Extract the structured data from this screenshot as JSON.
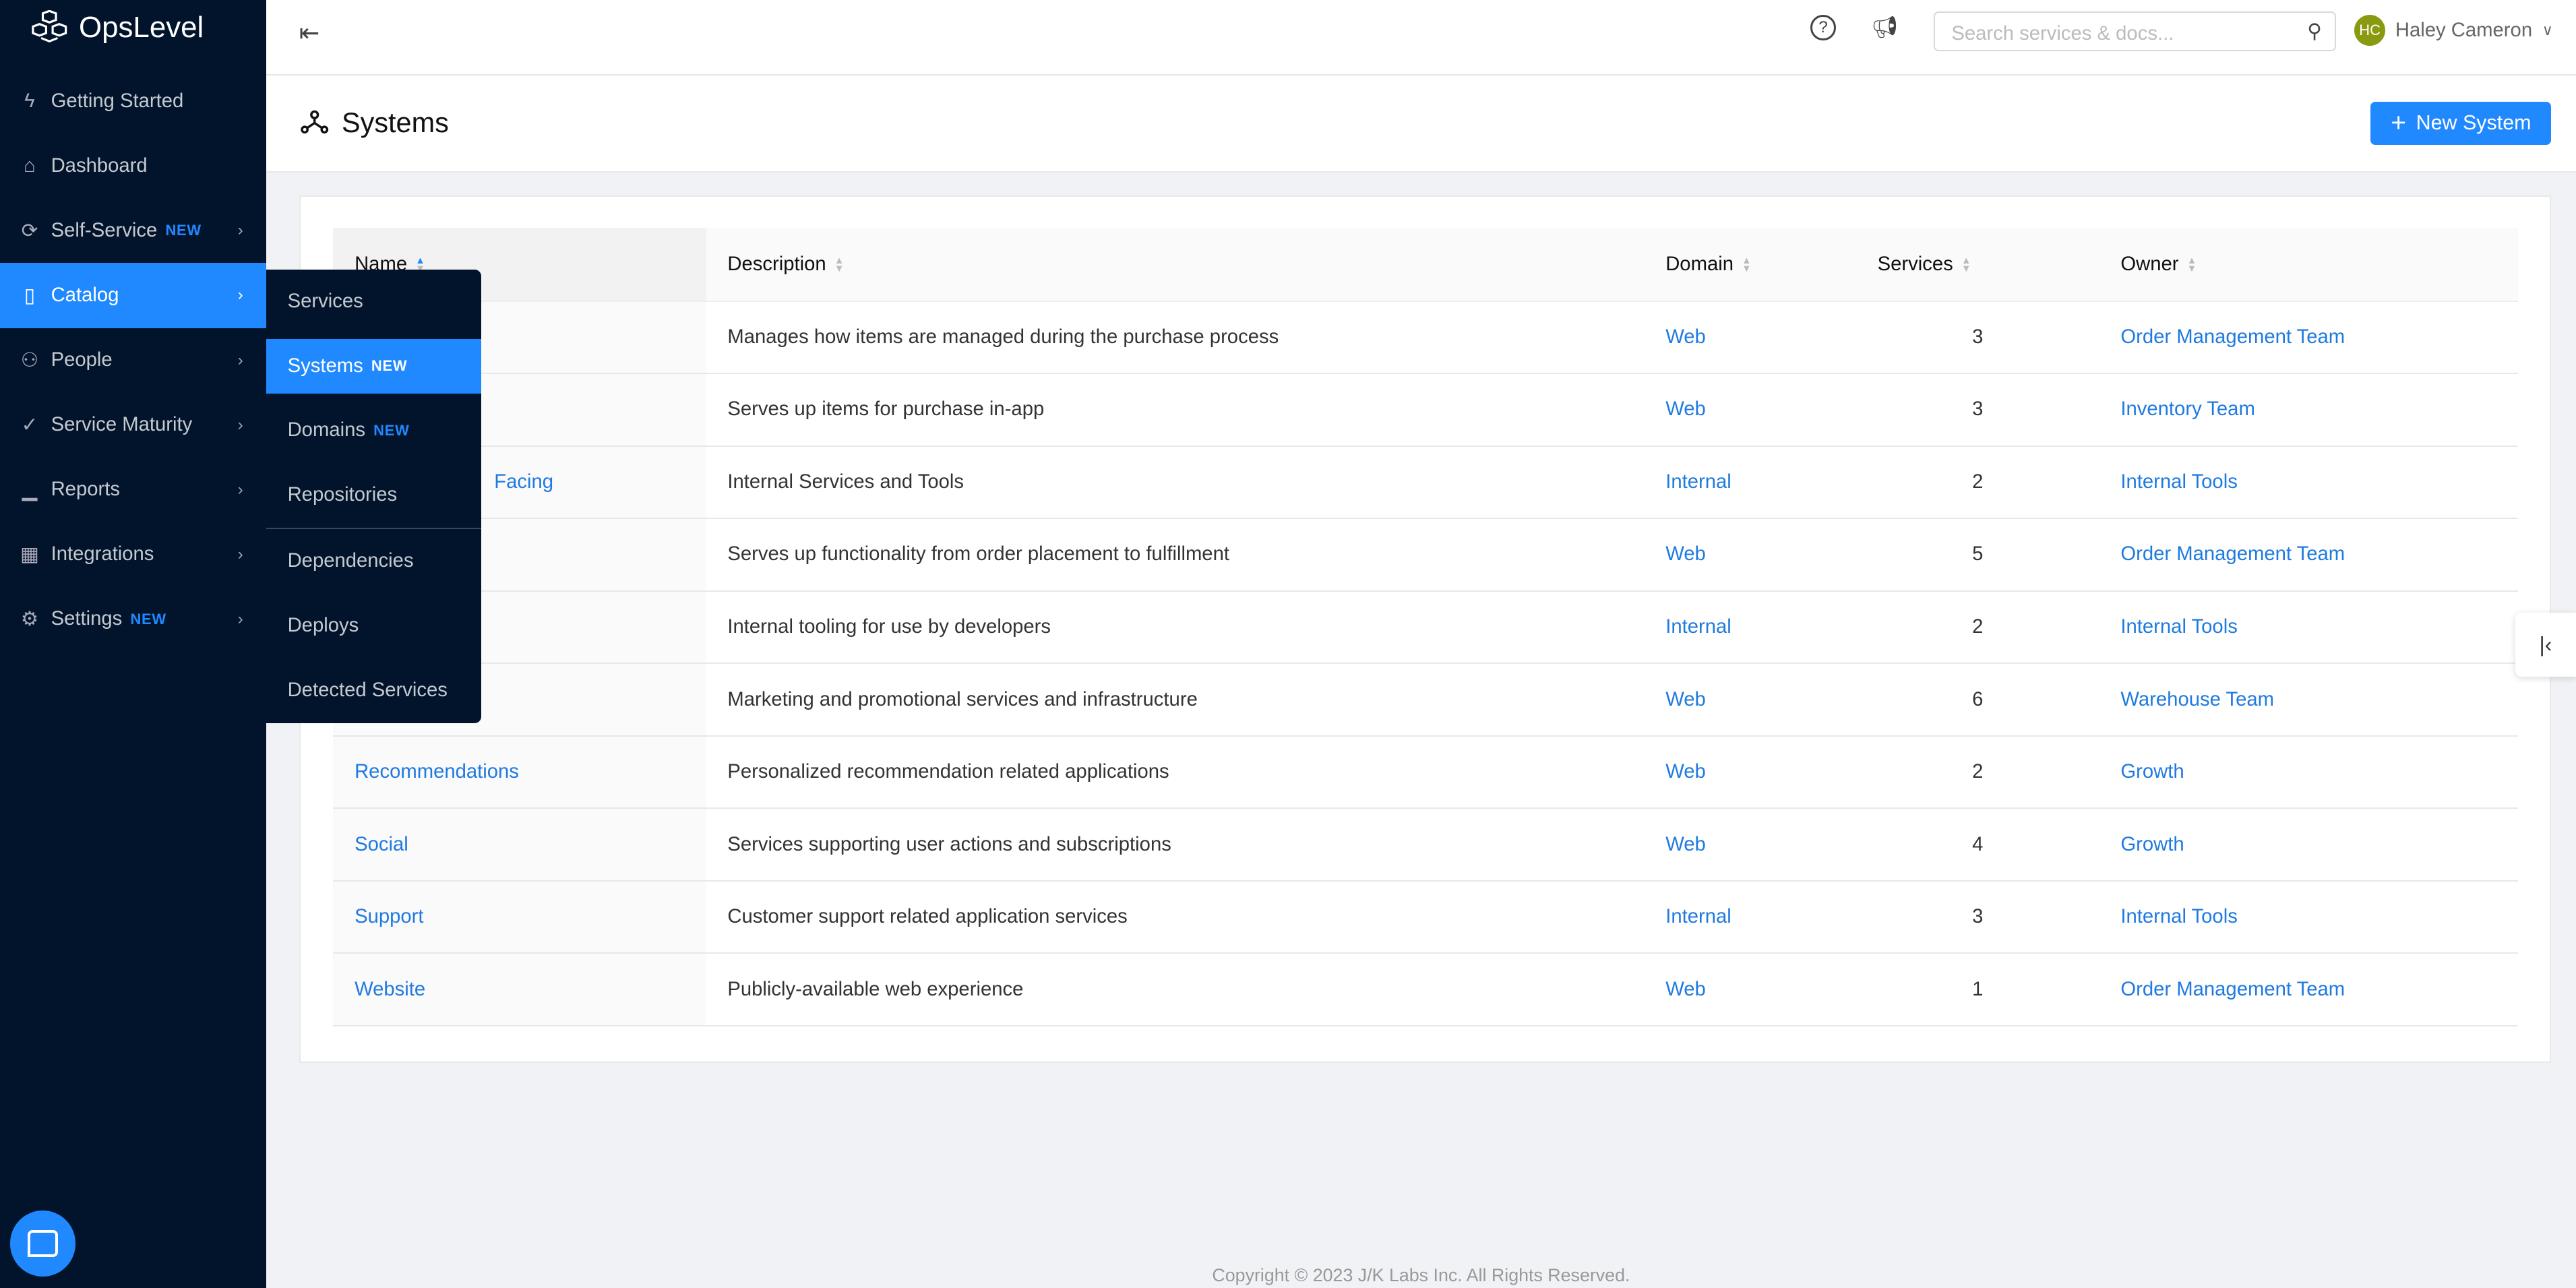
{
  "app": {
    "name": "OpsLevel"
  },
  "sidebar": {
    "items": [
      {
        "label": "Getting Started",
        "icon": "lightning-icon",
        "badge": "",
        "chevron": false
      },
      {
        "label": "Dashboard",
        "icon": "home-icon",
        "badge": "",
        "chevron": false
      },
      {
        "label": "Self-Service",
        "icon": "refresh-icon",
        "badge": "NEW",
        "chevron": true
      },
      {
        "label": "Catalog",
        "icon": "book-icon",
        "badge": "",
        "chevron": true,
        "active": true
      },
      {
        "label": "People",
        "icon": "people-icon",
        "badge": "",
        "chevron": true
      },
      {
        "label": "Service Maturity",
        "icon": "check-circle-icon",
        "badge": "",
        "chevron": true
      },
      {
        "label": "Reports",
        "icon": "chart-icon",
        "badge": "",
        "chevron": true
      },
      {
        "label": "Integrations",
        "icon": "grid-icon",
        "badge": "",
        "chevron": true
      },
      {
        "label": "Settings",
        "icon": "gear-icon",
        "badge": "NEW",
        "chevron": true
      }
    ]
  },
  "catalog_menu": [
    {
      "label": "Services",
      "badge": ""
    },
    {
      "label": "Systems",
      "badge": "NEW",
      "active": true
    },
    {
      "label": "Domains",
      "badge": "NEW"
    },
    {
      "label": "Repositories",
      "badge": ""
    },
    {
      "label": "Dependencies",
      "badge": ""
    },
    {
      "label": "Deploys",
      "badge": ""
    },
    {
      "label": "Detected Services",
      "badge": ""
    }
  ],
  "topbar": {
    "search_placeholder": "Search services & docs...",
    "user_initials": "HC",
    "user_name": "Haley Cameron",
    "avatar_color": "#8a9a10"
  },
  "page": {
    "title": "Systems",
    "new_button": "New System"
  },
  "table": {
    "columns": [
      "Name",
      "Description",
      "Domain",
      "Services",
      "Owner"
    ],
    "sorted_column": "Name",
    "sort_direction": "ascending",
    "rows": [
      {
        "name": "",
        "description": "Manages how items are managed during the purchase process",
        "domain": "Web",
        "services": "3",
        "owner": "Order Management Team"
      },
      {
        "name": "",
        "description": "Serves up items for purchase in-app",
        "domain": "Web",
        "services": "3",
        "owner": "Inventory Team"
      },
      {
        "name": "Facing",
        "description": "Internal Services and Tools",
        "domain": "Internal",
        "services": "2",
        "owner": "Internal Tools"
      },
      {
        "name": "",
        "description": "Serves up functionality from order placement to fulfillment",
        "domain": "Web",
        "services": "5",
        "owner": "Order Management Team"
      },
      {
        "name": "",
        "description": "Internal tooling for use by developers",
        "domain": "Internal",
        "services": "2",
        "owner": "Internal Tools"
      },
      {
        "name": "",
        "description": "Marketing and promotional services and infrastructure",
        "domain": "Web",
        "services": "6",
        "owner": "Warehouse Team"
      },
      {
        "name": "Recommendations",
        "description": "Personalized recommendation related applications",
        "domain": "Web",
        "services": "2",
        "owner": "Growth"
      },
      {
        "name": "Social",
        "description": "Services supporting user actions and subscriptions",
        "domain": "Web",
        "services": "4",
        "owner": "Growth"
      },
      {
        "name": "Support",
        "description": "Customer support related application services",
        "domain": "Internal",
        "services": "3",
        "owner": "Internal Tools"
      },
      {
        "name": "Website",
        "description": "Publicly-available web experience",
        "domain": "Web",
        "services": "1",
        "owner": "Order Management Team"
      }
    ]
  },
  "footer": {
    "copyright": "Copyright © 2023 J/K Labs Inc. All Rights Reserved."
  },
  "colors": {
    "accent": "#2089ff",
    "sidebar_bg": "#02142b",
    "link": "#1f7ae0"
  }
}
